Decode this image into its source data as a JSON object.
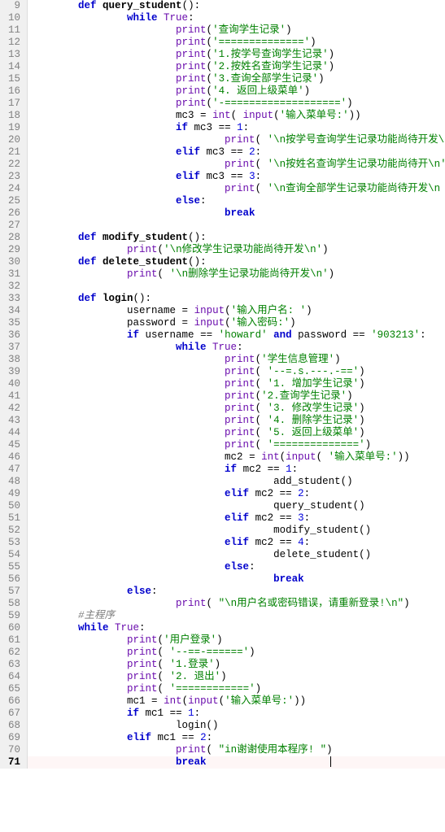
{
  "lines": [
    {
      "ln": 9,
      "ind": 2,
      "tok": [
        {
          "c": "kw",
          "t": "def "
        },
        {
          "c": "fn",
          "t": "query_student"
        },
        {
          "c": "op",
          "t": "():"
        }
      ]
    },
    {
      "ln": 10,
      "ind": 4,
      "tok": [
        {
          "c": "kw",
          "t": "while "
        },
        {
          "c": "builtin",
          "t": "True"
        },
        {
          "c": "op",
          "t": ":"
        }
      ]
    },
    {
      "ln": 11,
      "ind": 6,
      "tok": [
        {
          "c": "builtin",
          "t": "print"
        },
        {
          "c": "op",
          "t": "("
        },
        {
          "c": "str",
          "t": "'查询学生记录'"
        },
        {
          "c": "op",
          "t": ")"
        }
      ]
    },
    {
      "ln": 12,
      "ind": 6,
      "tok": [
        {
          "c": "builtin",
          "t": "print"
        },
        {
          "c": "op",
          "t": "("
        },
        {
          "c": "str",
          "t": "'=============='"
        },
        {
          "c": "op",
          "t": ")"
        }
      ]
    },
    {
      "ln": 13,
      "ind": 6,
      "tok": [
        {
          "c": "builtin",
          "t": "print"
        },
        {
          "c": "op",
          "t": "("
        },
        {
          "c": "str",
          "t": "'1.按学号查询学生记录'"
        },
        {
          "c": "op",
          "t": ")"
        }
      ]
    },
    {
      "ln": 14,
      "ind": 6,
      "tok": [
        {
          "c": "builtin",
          "t": "print"
        },
        {
          "c": "op",
          "t": "("
        },
        {
          "c": "str",
          "t": "'2.按姓名查询学生记录'"
        },
        {
          "c": "op",
          "t": ")"
        }
      ]
    },
    {
      "ln": 15,
      "ind": 6,
      "tok": [
        {
          "c": "builtin",
          "t": "print"
        },
        {
          "c": "op",
          "t": "("
        },
        {
          "c": "str",
          "t": "'3.查询全部学生记录'"
        },
        {
          "c": "op",
          "t": ")"
        }
      ]
    },
    {
      "ln": 16,
      "ind": 6,
      "tok": [
        {
          "c": "builtin",
          "t": "print"
        },
        {
          "c": "op",
          "t": "("
        },
        {
          "c": "str",
          "t": "'4. 返回上级菜单'"
        },
        {
          "c": "op",
          "t": ")"
        }
      ]
    },
    {
      "ln": 17,
      "ind": 6,
      "tok": [
        {
          "c": "builtin",
          "t": "print"
        },
        {
          "c": "op",
          "t": "("
        },
        {
          "c": "str",
          "t": "'-==================='"
        },
        {
          "c": "op",
          "t": ")"
        }
      ]
    },
    {
      "ln": 18,
      "ind": 6,
      "tok": [
        {
          "c": "text",
          "t": "mc3 "
        },
        {
          "c": "op",
          "t": "= "
        },
        {
          "c": "builtin",
          "t": "int"
        },
        {
          "c": "op",
          "t": "( "
        },
        {
          "c": "builtin",
          "t": "input"
        },
        {
          "c": "op",
          "t": "("
        },
        {
          "c": "str",
          "t": "'输入菜单号:'"
        },
        {
          "c": "op",
          "t": "))"
        }
      ]
    },
    {
      "ln": 19,
      "ind": 6,
      "tok": [
        {
          "c": "kw",
          "t": "if "
        },
        {
          "c": "text",
          "t": "mc3 "
        },
        {
          "c": "op",
          "t": "== "
        },
        {
          "c": "num",
          "t": "1"
        },
        {
          "c": "op",
          "t": ":"
        }
      ]
    },
    {
      "ln": 20,
      "ind": 8,
      "tok": [
        {
          "c": "builtin",
          "t": "print"
        },
        {
          "c": "op",
          "t": "( "
        },
        {
          "c": "str",
          "t": "'\\n按学号查询学生记录功能尚待开发\\n '"
        },
        {
          "c": "op",
          "t": ")"
        }
      ]
    },
    {
      "ln": 21,
      "ind": 6,
      "tok": [
        {
          "c": "kw",
          "t": "elif "
        },
        {
          "c": "text",
          "t": "mc3 "
        },
        {
          "c": "op",
          "t": "== "
        },
        {
          "c": "num",
          "t": "2"
        },
        {
          "c": "op",
          "t": ":"
        }
      ]
    },
    {
      "ln": 22,
      "ind": 8,
      "tok": [
        {
          "c": "builtin",
          "t": "print"
        },
        {
          "c": "op",
          "t": "( "
        },
        {
          "c": "str",
          "t": "'\\n按姓名查询学生记录功能尚待开\\n'"
        },
        {
          "c": "op",
          "t": ")"
        }
      ]
    },
    {
      "ln": 23,
      "ind": 6,
      "tok": [
        {
          "c": "kw",
          "t": "elif "
        },
        {
          "c": "text",
          "t": "mc3 "
        },
        {
          "c": "op",
          "t": "== "
        },
        {
          "c": "num",
          "t": "3"
        },
        {
          "c": "op",
          "t": ":"
        }
      ]
    },
    {
      "ln": 24,
      "ind": 8,
      "tok": [
        {
          "c": "builtin",
          "t": "print"
        },
        {
          "c": "op",
          "t": "( "
        },
        {
          "c": "str",
          "t": "'\\n查询全部学生记录功能尚待开发\\n '"
        },
        {
          "c": "op",
          "t": ")"
        }
      ]
    },
    {
      "ln": 25,
      "ind": 6,
      "tok": [
        {
          "c": "kw",
          "t": "else"
        },
        {
          "c": "op",
          "t": ":"
        }
      ]
    },
    {
      "ln": 26,
      "ind": 8,
      "tok": [
        {
          "c": "kw",
          "t": "break"
        }
      ]
    },
    {
      "ln": 27,
      "ind": 0,
      "tok": []
    },
    {
      "ln": 28,
      "ind": 2,
      "tok": [
        {
          "c": "kw",
          "t": "def "
        },
        {
          "c": "fn",
          "t": "modify_student"
        },
        {
          "c": "op",
          "t": "():"
        }
      ]
    },
    {
      "ln": 29,
      "ind": 4,
      "tok": [
        {
          "c": "builtin",
          "t": "print"
        },
        {
          "c": "op",
          "t": "("
        },
        {
          "c": "str",
          "t": "'\\n修改学生记录功能尚待开发\\n'"
        },
        {
          "c": "op",
          "t": ")"
        }
      ]
    },
    {
      "ln": 30,
      "ind": 2,
      "tok": [
        {
          "c": "kw",
          "t": "def "
        },
        {
          "c": "fn",
          "t": "delete_student"
        },
        {
          "c": "op",
          "t": "():"
        }
      ]
    },
    {
      "ln": 31,
      "ind": 4,
      "tok": [
        {
          "c": "builtin",
          "t": "print"
        },
        {
          "c": "op",
          "t": "( "
        },
        {
          "c": "str",
          "t": "'\\n删除学生记录功能尚待开发\\n'"
        },
        {
          "c": "op",
          "t": ")"
        }
      ]
    },
    {
      "ln": 32,
      "ind": 0,
      "tok": []
    },
    {
      "ln": 33,
      "ind": 2,
      "tok": [
        {
          "c": "kw",
          "t": "def "
        },
        {
          "c": "fn",
          "t": "login"
        },
        {
          "c": "op",
          "t": "():"
        }
      ]
    },
    {
      "ln": 34,
      "ind": 4,
      "tok": [
        {
          "c": "text",
          "t": "username "
        },
        {
          "c": "op",
          "t": "= "
        },
        {
          "c": "builtin",
          "t": "input"
        },
        {
          "c": "op",
          "t": "("
        },
        {
          "c": "str",
          "t": "'输入用户名: '"
        },
        {
          "c": "op",
          "t": ")"
        }
      ]
    },
    {
      "ln": 35,
      "ind": 4,
      "tok": [
        {
          "c": "text",
          "t": "password "
        },
        {
          "c": "op",
          "t": "= "
        },
        {
          "c": "builtin",
          "t": "input"
        },
        {
          "c": "op",
          "t": "("
        },
        {
          "c": "str",
          "t": "'输入密码:'"
        },
        {
          "c": "op",
          "t": ")"
        }
      ]
    },
    {
      "ln": 36,
      "ind": 4,
      "tok": [
        {
          "c": "kw",
          "t": "if "
        },
        {
          "c": "text",
          "t": "username "
        },
        {
          "c": "op",
          "t": "== "
        },
        {
          "c": "str",
          "t": "'howard'"
        },
        {
          "c": "kw",
          "t": " and "
        },
        {
          "c": "text",
          "t": "password "
        },
        {
          "c": "op",
          "t": "== "
        },
        {
          "c": "str",
          "t": "'903213'"
        },
        {
          "c": "op",
          "t": ":"
        }
      ]
    },
    {
      "ln": 37,
      "ind": 6,
      "tok": [
        {
          "c": "kw",
          "t": "while "
        },
        {
          "c": "builtin",
          "t": "True"
        },
        {
          "c": "op",
          "t": ":"
        }
      ]
    },
    {
      "ln": 38,
      "ind": 8,
      "tok": [
        {
          "c": "builtin",
          "t": "print"
        },
        {
          "c": "op",
          "t": "("
        },
        {
          "c": "str",
          "t": "'学生信息管理'"
        },
        {
          "c": "op",
          "t": ")"
        }
      ]
    },
    {
      "ln": 39,
      "ind": 8,
      "tok": [
        {
          "c": "builtin",
          "t": "print"
        },
        {
          "c": "op",
          "t": "( "
        },
        {
          "c": "str",
          "t": "'--=.s.---.-=='"
        },
        {
          "c": "op",
          "t": ")"
        }
      ]
    },
    {
      "ln": 40,
      "ind": 8,
      "tok": [
        {
          "c": "builtin",
          "t": "print"
        },
        {
          "c": "op",
          "t": "( "
        },
        {
          "c": "str",
          "t": "'1. 增加学生记录'"
        },
        {
          "c": "op",
          "t": ")"
        }
      ]
    },
    {
      "ln": 41,
      "ind": 8,
      "tok": [
        {
          "c": "builtin",
          "t": "print"
        },
        {
          "c": "op",
          "t": "("
        },
        {
          "c": "str",
          "t": "'2.查询学生记录'"
        },
        {
          "c": "op",
          "t": ")"
        }
      ]
    },
    {
      "ln": 42,
      "ind": 8,
      "tok": [
        {
          "c": "builtin",
          "t": "print"
        },
        {
          "c": "op",
          "t": "( "
        },
        {
          "c": "str",
          "t": "'3. 修改学生记录'"
        },
        {
          "c": "op",
          "t": ")"
        }
      ]
    },
    {
      "ln": 43,
      "ind": 8,
      "tok": [
        {
          "c": "builtin",
          "t": "print"
        },
        {
          "c": "op",
          "t": "( "
        },
        {
          "c": "str",
          "t": "'4. 删除学生记录'"
        },
        {
          "c": "op",
          "t": ")"
        }
      ]
    },
    {
      "ln": 44,
      "ind": 8,
      "tok": [
        {
          "c": "builtin",
          "t": "print"
        },
        {
          "c": "op",
          "t": "( "
        },
        {
          "c": "str",
          "t": "'5. 返回上级菜单'"
        },
        {
          "c": "op",
          "t": ")"
        }
      ]
    },
    {
      "ln": 45,
      "ind": 8,
      "tok": [
        {
          "c": "builtin",
          "t": "print"
        },
        {
          "c": "op",
          "t": "( "
        },
        {
          "c": "str",
          "t": "'=============='"
        },
        {
          "c": "op",
          "t": ")"
        }
      ]
    },
    {
      "ln": 46,
      "ind": 8,
      "tok": [
        {
          "c": "text",
          "t": "mc2 "
        },
        {
          "c": "op",
          "t": "= "
        },
        {
          "c": "builtin",
          "t": "int"
        },
        {
          "c": "op",
          "t": "("
        },
        {
          "c": "builtin",
          "t": "input"
        },
        {
          "c": "op",
          "t": "( "
        },
        {
          "c": "str",
          "t": "'输入菜单号:'"
        },
        {
          "c": "op",
          "t": "))"
        }
      ]
    },
    {
      "ln": 47,
      "ind": 8,
      "tok": [
        {
          "c": "kw",
          "t": "if "
        },
        {
          "c": "text",
          "t": "mc2 "
        },
        {
          "c": "op",
          "t": "== "
        },
        {
          "c": "num",
          "t": "1"
        },
        {
          "c": "op",
          "t": ":"
        }
      ]
    },
    {
      "ln": 48,
      "ind": 10,
      "tok": [
        {
          "c": "text",
          "t": "add_student()"
        }
      ]
    },
    {
      "ln": 49,
      "ind": 8,
      "tok": [
        {
          "c": "kw",
          "t": "elif "
        },
        {
          "c": "text",
          "t": "mc2 "
        },
        {
          "c": "op",
          "t": "== "
        },
        {
          "c": "num",
          "t": "2"
        },
        {
          "c": "op",
          "t": ":"
        }
      ]
    },
    {
      "ln": 50,
      "ind": 10,
      "tok": [
        {
          "c": "text",
          "t": "query_student()"
        }
      ]
    },
    {
      "ln": 51,
      "ind": 8,
      "tok": [
        {
          "c": "kw",
          "t": "elif "
        },
        {
          "c": "text",
          "t": "mc2 "
        },
        {
          "c": "op",
          "t": "== "
        },
        {
          "c": "num",
          "t": "3"
        },
        {
          "c": "op",
          "t": ":"
        }
      ]
    },
    {
      "ln": 52,
      "ind": 10,
      "tok": [
        {
          "c": "text",
          "t": "modify_student()"
        }
      ]
    },
    {
      "ln": 53,
      "ind": 8,
      "tok": [
        {
          "c": "kw",
          "t": "elif "
        },
        {
          "c": "text",
          "t": "mc2 "
        },
        {
          "c": "op",
          "t": "== "
        },
        {
          "c": "num",
          "t": "4"
        },
        {
          "c": "op",
          "t": ":"
        }
      ]
    },
    {
      "ln": 54,
      "ind": 10,
      "tok": [
        {
          "c": "text",
          "t": "delete_student()"
        }
      ]
    },
    {
      "ln": 55,
      "ind": 8,
      "tok": [
        {
          "c": "kw",
          "t": "else"
        },
        {
          "c": "op",
          "t": ":"
        }
      ]
    },
    {
      "ln": 56,
      "ind": 10,
      "tok": [
        {
          "c": "kw",
          "t": "break"
        }
      ]
    },
    {
      "ln": 57,
      "ind": 4,
      "tok": [
        {
          "c": "kw",
          "t": "else"
        },
        {
          "c": "op",
          "t": ":"
        }
      ]
    },
    {
      "ln": 58,
      "ind": 6,
      "tok": [
        {
          "c": "builtin",
          "t": "print"
        },
        {
          "c": "op",
          "t": "( "
        },
        {
          "c": "str",
          "t": "\"\\n用户名或密码错误，请重新登录!\\n\""
        },
        {
          "c": "op",
          "t": ")"
        }
      ]
    },
    {
      "ln": 59,
      "ind": 2,
      "tok": [
        {
          "c": "comment",
          "t": "#主程序"
        }
      ]
    },
    {
      "ln": 60,
      "ind": 2,
      "tok": [
        {
          "c": "kw",
          "t": "while "
        },
        {
          "c": "builtin",
          "t": "True"
        },
        {
          "c": "op",
          "t": ":"
        }
      ]
    },
    {
      "ln": 61,
      "ind": 4,
      "tok": [
        {
          "c": "builtin",
          "t": "print"
        },
        {
          "c": "op",
          "t": "("
        },
        {
          "c": "str",
          "t": "'用户登录'"
        },
        {
          "c": "op",
          "t": ")"
        }
      ]
    },
    {
      "ln": 62,
      "ind": 4,
      "tok": [
        {
          "c": "builtin",
          "t": "print"
        },
        {
          "c": "op",
          "t": "( "
        },
        {
          "c": "str",
          "t": "'--==-======'"
        },
        {
          "c": "op",
          "t": ")"
        }
      ]
    },
    {
      "ln": 63,
      "ind": 4,
      "tok": [
        {
          "c": "builtin",
          "t": "print"
        },
        {
          "c": "op",
          "t": "( "
        },
        {
          "c": "str",
          "t": "'1.登录'"
        },
        {
          "c": "op",
          "t": ")"
        }
      ]
    },
    {
      "ln": 64,
      "ind": 4,
      "tok": [
        {
          "c": "builtin",
          "t": "print"
        },
        {
          "c": "op",
          "t": "( "
        },
        {
          "c": "str",
          "t": "'2. 退出'"
        },
        {
          "c": "op",
          "t": ")"
        }
      ]
    },
    {
      "ln": 65,
      "ind": 4,
      "tok": [
        {
          "c": "builtin",
          "t": "print"
        },
        {
          "c": "op",
          "t": "( "
        },
        {
          "c": "str",
          "t": "'============'"
        },
        {
          "c": "op",
          "t": ")"
        }
      ]
    },
    {
      "ln": 66,
      "ind": 4,
      "tok": [
        {
          "c": "text",
          "t": "mc1 "
        },
        {
          "c": "op",
          "t": "= "
        },
        {
          "c": "builtin",
          "t": "int"
        },
        {
          "c": "op",
          "t": "("
        },
        {
          "c": "builtin",
          "t": "input"
        },
        {
          "c": "op",
          "t": "("
        },
        {
          "c": "str",
          "t": "'输入菜单号:'"
        },
        {
          "c": "op",
          "t": "))"
        }
      ]
    },
    {
      "ln": 67,
      "ind": 4,
      "tok": [
        {
          "c": "kw",
          "t": "if "
        },
        {
          "c": "text",
          "t": "mc1 "
        },
        {
          "c": "op",
          "t": "== "
        },
        {
          "c": "num",
          "t": "1"
        },
        {
          "c": "op",
          "t": ":"
        }
      ]
    },
    {
      "ln": 68,
      "ind": 6,
      "tok": [
        {
          "c": "text",
          "t": "login()"
        }
      ]
    },
    {
      "ln": 69,
      "ind": 4,
      "tok": [
        {
          "c": "kw",
          "t": "elif "
        },
        {
          "c": "text",
          "t": "mc1 "
        },
        {
          "c": "op",
          "t": "== "
        },
        {
          "c": "num",
          "t": "2"
        },
        {
          "c": "op",
          "t": ":"
        }
      ]
    },
    {
      "ln": 70,
      "ind": 6,
      "tok": [
        {
          "c": "builtin",
          "t": "print"
        },
        {
          "c": "op",
          "t": "( "
        },
        {
          "c": "str",
          "t": "\"in谢谢使用本程序! \""
        },
        {
          "c": "op",
          "t": ")"
        }
      ]
    },
    {
      "ln": 71,
      "ind": 6,
      "tok": [
        {
          "c": "kw",
          "t": "break"
        }
      ],
      "current": true
    }
  ],
  "indent_unit": "    "
}
